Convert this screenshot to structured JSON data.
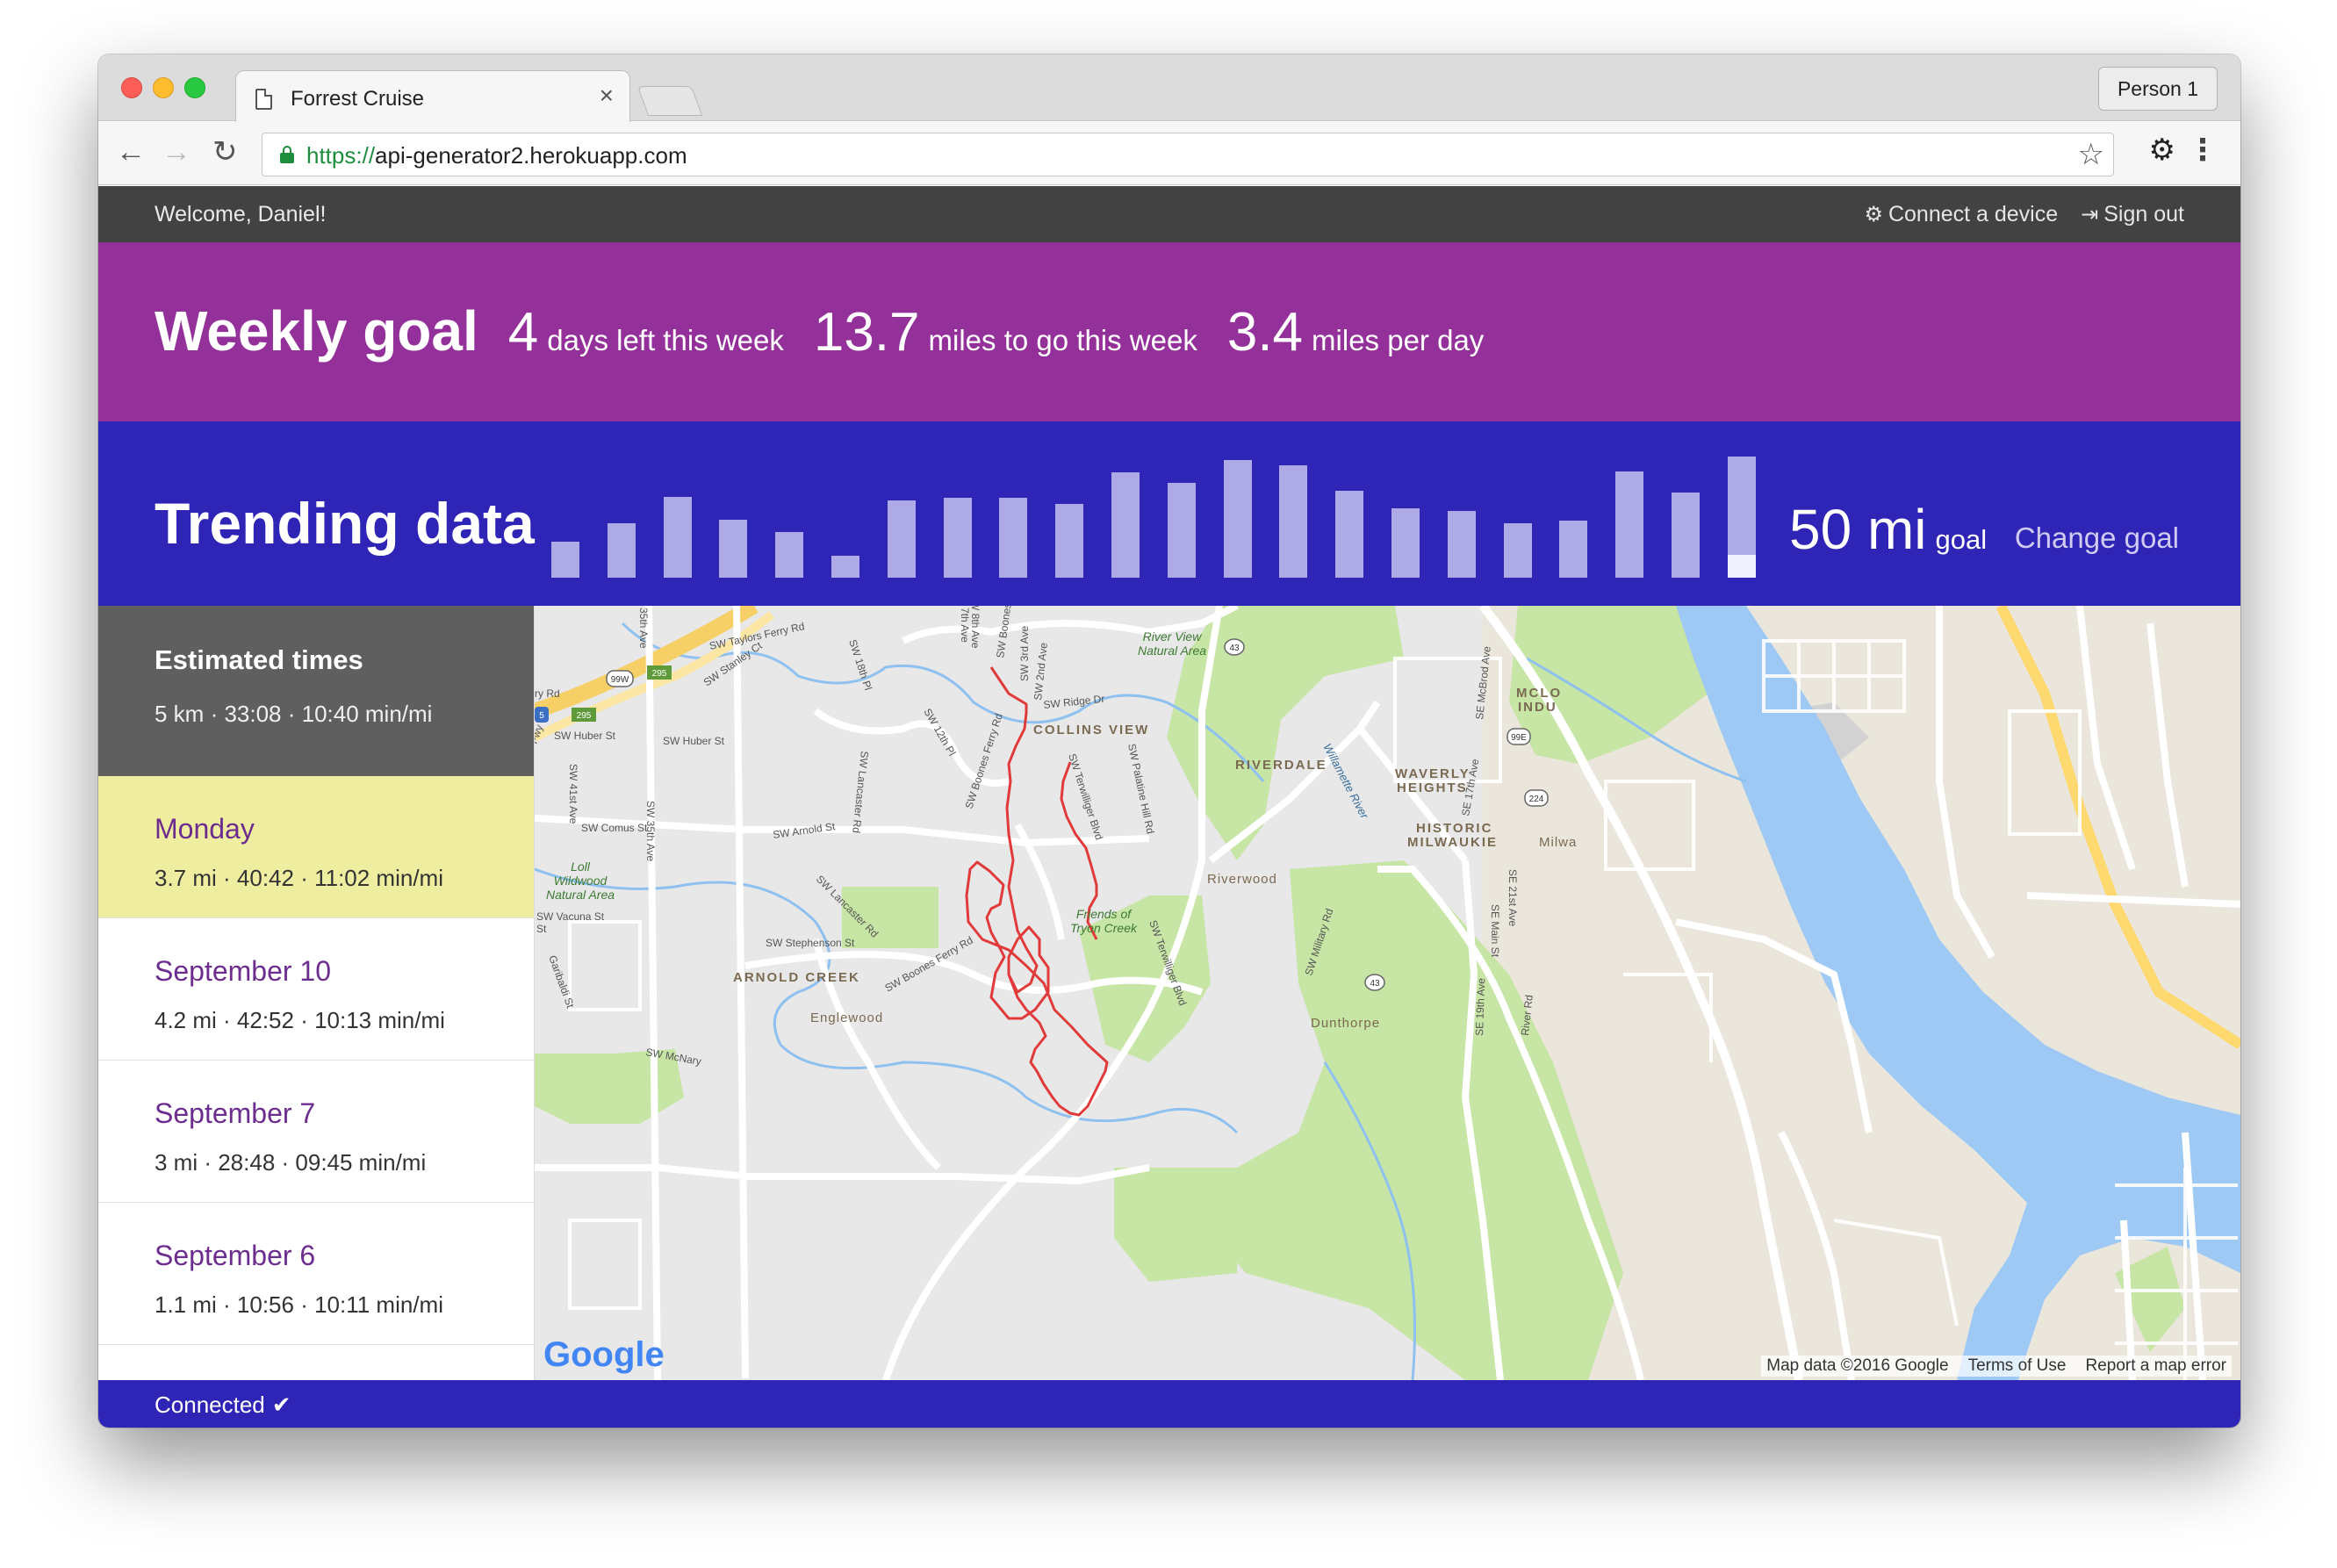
{
  "browser": {
    "tab_title": "Forrest Cruise",
    "profile": "Person 1",
    "url_scheme": "https://",
    "url_host": "api-generator2.herokuapp.com"
  },
  "header": {
    "welcome": "Welcome, Daniel!",
    "connect_device": "Connect a device",
    "sign_out": "Sign out"
  },
  "weekly_goal": {
    "title": "Weekly goal",
    "stats": [
      {
        "value": "4",
        "label": "days left this week"
      },
      {
        "value": "13.7",
        "label": "miles to go this week"
      },
      {
        "value": "3.4",
        "label": "miles per day"
      }
    ]
  },
  "trending": {
    "title": "Trending data",
    "goal_value": "50 mi",
    "goal_label": "goal",
    "change_goal": "Change goal",
    "bar_color": "#aeaae6",
    "current_fill_color": "#f0f0ff",
    "bar_levels": [
      0.3,
      0.45,
      0.67,
      0.48,
      0.38,
      0.18,
      0.64,
      0.66,
      0.66,
      0.61,
      0.87,
      0.78,
      0.97,
      0.93,
      0.72,
      0.57,
      0.55,
      0.45,
      0.47,
      0.88,
      0.7,
      1.0
    ],
    "current_week_progress": 0.19
  },
  "estimates": {
    "title": "Estimated times",
    "stats": "5 km · 33:08 · 10:40 min/mi"
  },
  "runs": [
    {
      "day": "Monday",
      "stats": "3.7 mi · 40:42 · 11:02 min/mi",
      "active": true
    },
    {
      "day": "September 10",
      "stats": "4.2 mi · 42:52 · 10:13 min/mi",
      "active": false
    },
    {
      "day": "September 7",
      "stats": "3 mi · 28:48 · 09:45 min/mi",
      "active": false
    },
    {
      "day": "September 6",
      "stats": "1.1 mi · 10:56 · 10:11 min/mi",
      "active": false
    }
  ],
  "map": {
    "logo": "Google",
    "labels": {
      "taylors_ferry": "SW Taylors Ferry Rd",
      "stanley": "SW Stanley Ct",
      "eighteenth": "SW 18th Pl",
      "huber_w": "SW Huber St",
      "huber": "SW Huber St",
      "lancaster_n": "SW Lancaster Rd",
      "comus": "SW Comus St",
      "arnold": "SW Arnold St",
      "lancaster_s": "SW Lancaster Rd",
      "stephenson": "SW Stephenson St",
      "boones_ferry_s": "SW Boones Ferry Rd",
      "boones_ferry_n": "SW Boones Ferry Rd",
      "boones_ferry_top": "SW Boones",
      "twelfth": "SW 12th Pl",
      "ridge": "SW Ridge Dr",
      "third": "SW 3rd Ave",
      "second": "SW 2nd Ave",
      "terwilliger_n": "SW Terwilliger Blvd",
      "terwilliger_s": "SW Terwilliger Blvd",
      "palatine": "SW Palatine Hill Rd",
      "military": "SW Military Rd",
      "thirtyfifth": "SW 35th Ave",
      "thirtyfifth_n": "35th Ave",
      "fortyfirst": "SW 41st Ave",
      "vacuna": "SW Vacuna St",
      "vacuna_st": "St",
      "garibaldi": "Garibaldi St",
      "ry_rd": "ry Rd",
      "seventh": "7th Ave",
      "eighth": "W 8th Ave",
      "mcnary": "SW McNary",
      "fwy": "Fwy",
      "mcbrod": "SE McBrod Ave",
      "seventeenth": "SE 17th Ave",
      "main": "SE Main St",
      "twentyfirst": "SE 21st Ave",
      "nineteenth": "SE 19th Ave",
      "river_rd": "River Rd",
      "willamette": "Willamette River",
      "river_view": "River View",
      "natural_area": "Natural Area",
      "loll": "Loll",
      "wildwood": "Wildwood",
      "natural_area_2": "Natural Area",
      "friends_of": "Friends of",
      "tryon": "Tryon Creek",
      "collins": "COLLINS VIEW",
      "riverdale": "RIVERDALE",
      "waverly": "WAVERLY",
      "heights": "HEIGHTS",
      "historic": "HISTORIC",
      "milwaukie": "MILWAUKIE",
      "milwa": "Milwa",
      "mclo": "MCLO",
      "indu": "INDU",
      "riverwood": "Riverwood",
      "arnold_creek": "ARNOLD CREEK",
      "englewood": "Englewood",
      "dunthorpe": "Dunthorpe",
      "shield_99w": "99W",
      "shield_295a": "295",
      "shield_295b": "295",
      "shield_5": "5",
      "shield_43a": "43",
      "shield_43b": "43",
      "shield_99e": "99E",
      "shield_224": "224"
    },
    "attribution": {
      "data": "Map data ©2016 Google",
      "terms": "Terms of Use",
      "report": "Report a map error"
    }
  },
  "footer": {
    "status": "Connected",
    "check": "✔"
  }
}
